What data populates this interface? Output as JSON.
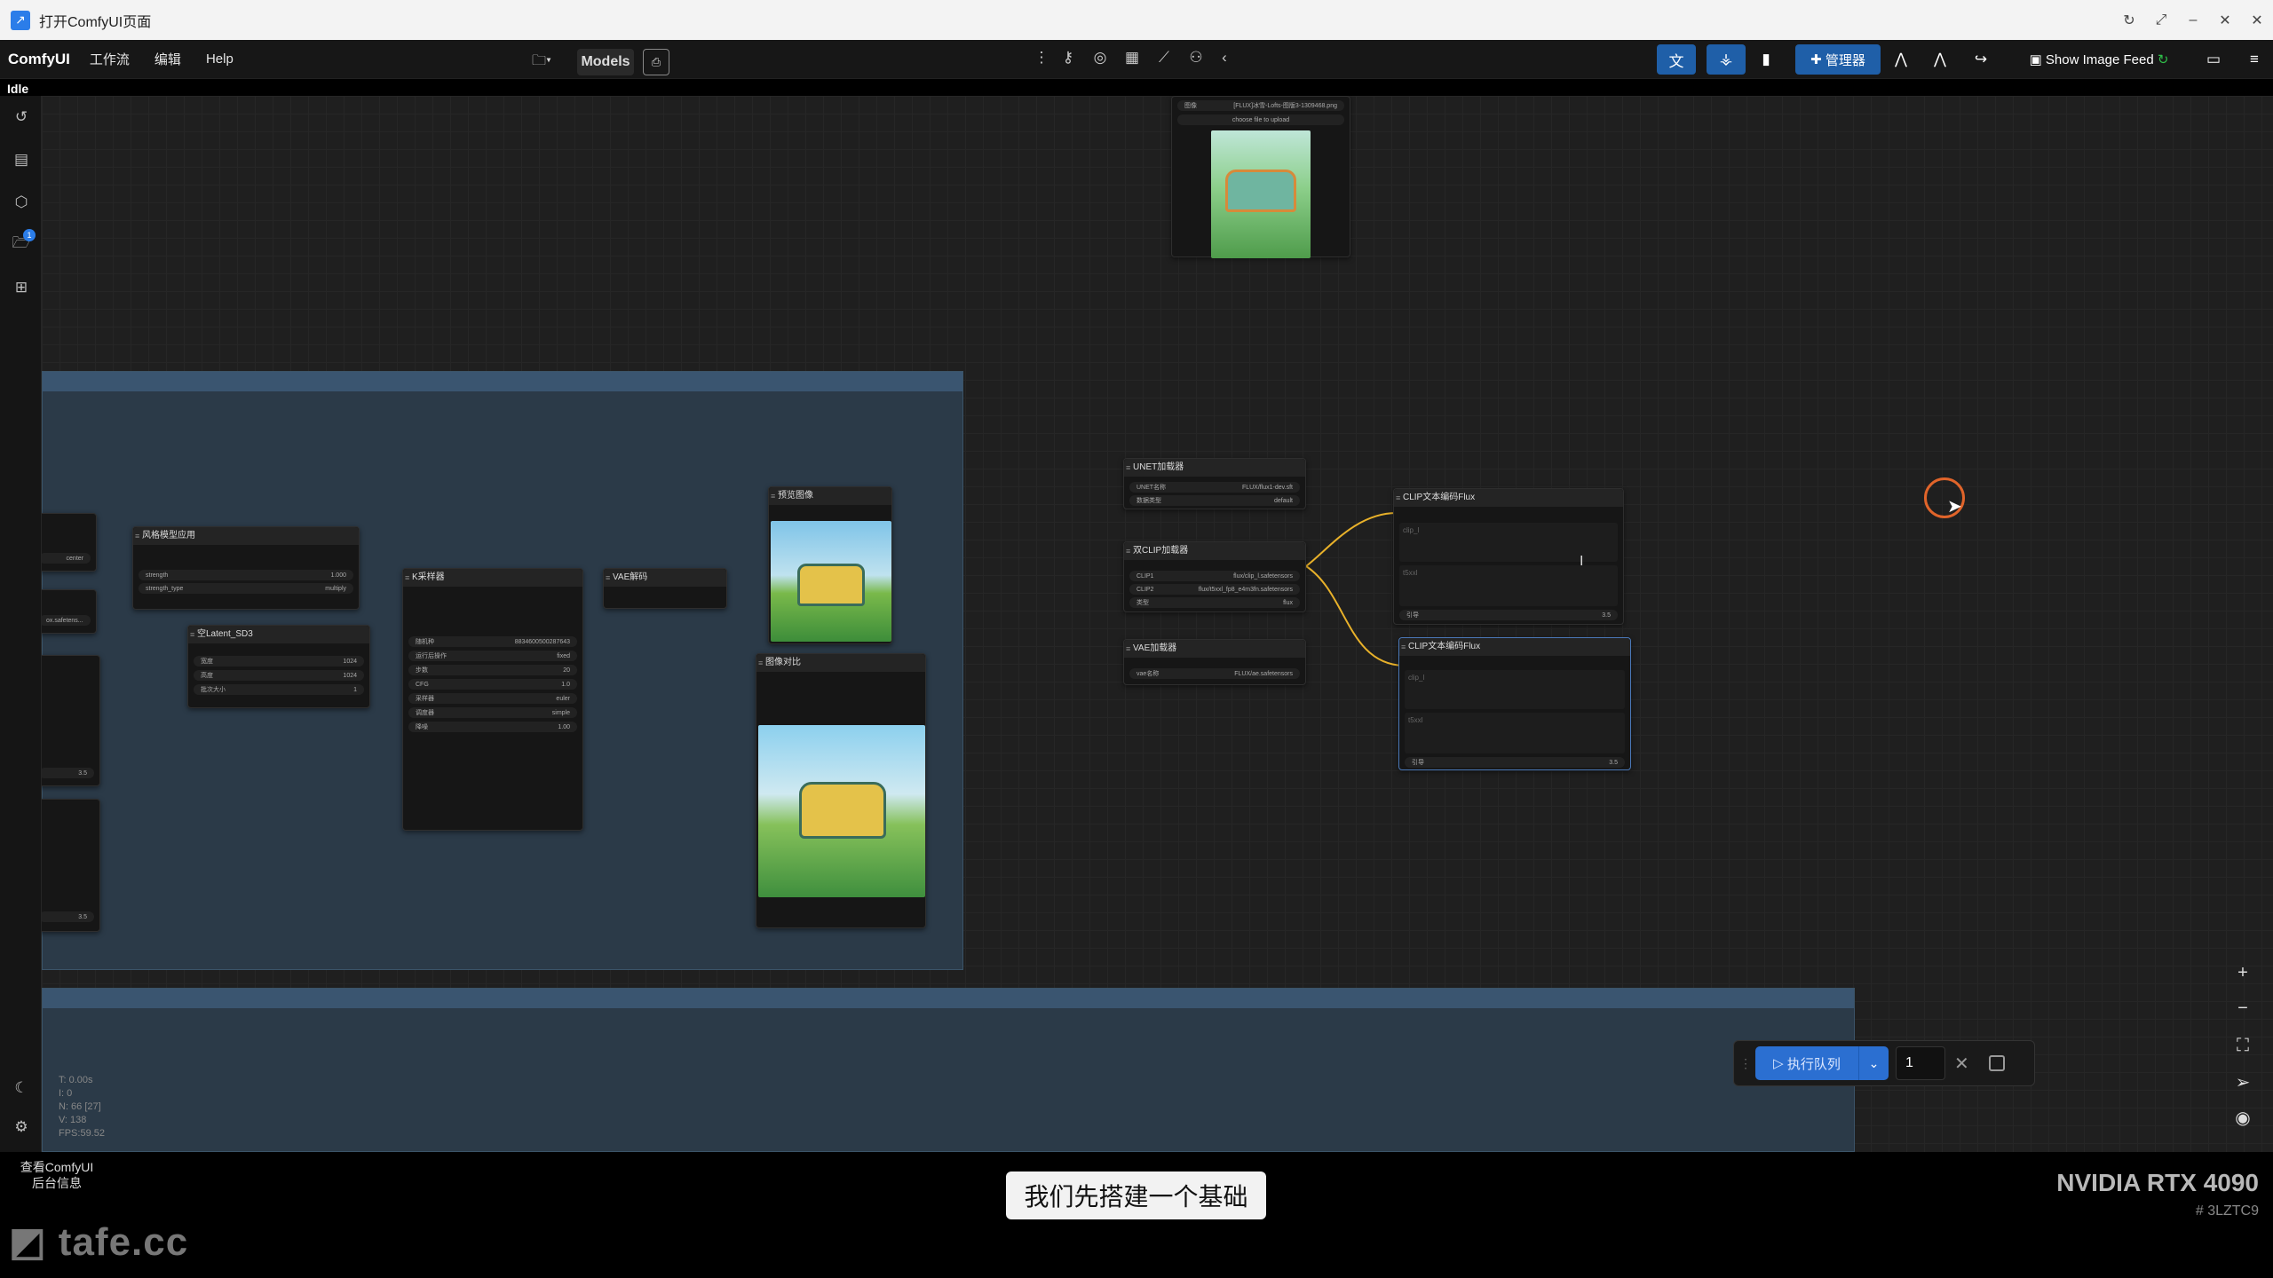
{
  "window": {
    "title": "打开ComfyUI页面",
    "controls": [
      "↻",
      "⤢",
      "–",
      "✕",
      "✕"
    ]
  },
  "menubar": {
    "brand": "ComfyUI",
    "items": [
      "工作流",
      "编辑",
      "Help"
    ],
    "models_label": "Models"
  },
  "toolbar_right": {
    "manager_label": "管理器",
    "image_feed_label": "Show Image Feed"
  },
  "status": {
    "state": "Idle"
  },
  "sidebar": {
    "badge_count": "1"
  },
  "nodes": {
    "load_image": {
      "file": "[FLUX]冰雪-Lofts-图版3-1309468.png",
      "upload": "choose file to upload",
      "row_label": "图像"
    },
    "style_apply": {
      "title": "风格模型应用",
      "w1_label": "strength",
      "w1_value": "1.000",
      "w2_label": "strength_type",
      "w2_value": "multiply"
    },
    "latent": {
      "title": "空Latent_SD3",
      "w1_label": "宽度",
      "w1_value": "1024",
      "w2_label": "高度",
      "w2_value": "1024",
      "w3_label": "批次大小",
      "w3_value": "1"
    },
    "ksampler": {
      "title": "K采样器",
      "rows": [
        [
          "随机种",
          "8834600500287643"
        ],
        [
          "运行后操作",
          "fixed"
        ],
        [
          "步数",
          "20"
        ],
        [
          "CFG",
          "1.0"
        ],
        [
          "采样器",
          "euler"
        ],
        [
          "调度器",
          "simple"
        ],
        [
          "降噪",
          "1.00"
        ]
      ]
    },
    "vae_decode": {
      "title": "VAE解码"
    },
    "preview": {
      "title": "预览图像"
    },
    "compare": {
      "title": "图像对比"
    },
    "unet": {
      "title": "UNET加载器",
      "w1_label": "UNET名称",
      "w1_value": "FLUX/flux1-dev.sft",
      "w2_label": "数据类型",
      "w2_value": "default"
    },
    "dualclip": {
      "title": "双CLIP加载器",
      "w1_label": "CLIP1",
      "w1_value": "flux/clip_l.safetensors",
      "w2_label": "CLIP2",
      "w2_value": "flux/t5xxl_fp8_e4m3fn.safetensors",
      "w3_label": "类型",
      "w3_value": "flux"
    },
    "vae_loader": {
      "title": "VAE加载器",
      "w1_label": "vae名称",
      "w1_value": "FLUX/ae.safetensors"
    },
    "clip_flux_1": {
      "title": "CLIP文本编码Flux",
      "field1": "clip_l",
      "field2": "t5xxl",
      "guidance_label": "引导",
      "guidance_value": "3.5"
    },
    "clip_flux_2": {
      "title": "CLIP文本编码Flux",
      "field1": "clip_l",
      "field2": "t5xxl",
      "guidance_label": "引导",
      "guidance_value": "3.5"
    },
    "left_partial": {
      "w1": "center",
      "w2": "ox.safetens...",
      "v1": "3.5",
      "v2": "3.5"
    }
  },
  "stats": {
    "lines": [
      "T: 0.00s",
      "I: 0",
      "N: 66 [27]",
      "V: 138",
      "FPS:59.52"
    ]
  },
  "runbar": {
    "label": "执行队列",
    "count": "1"
  },
  "console": {
    "label": "查看ComfyUI 后台信息"
  },
  "subtitle": "我们先搭建一个基础",
  "gpu": {
    "name": "NVIDIA RTX 4090",
    "code": "# 3LZTC9"
  },
  "watermark": "tafe.cc"
}
